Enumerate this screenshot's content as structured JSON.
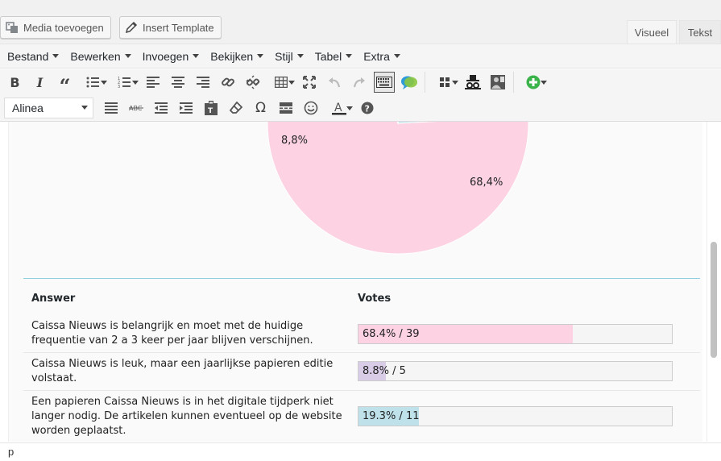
{
  "media_bar": {
    "add_media_label": "Media toevoegen",
    "insert_template_label": "Insert Template"
  },
  "tabs": {
    "visual": "Visueel",
    "text": "Tekst"
  },
  "menubar": [
    "Bestand",
    "Bewerken",
    "Invoegen",
    "Bekijken",
    "Stijl",
    "Tabel",
    "Extra"
  ],
  "format_select": {
    "value": "Alinea"
  },
  "pie": {
    "labels": [
      "8,8%",
      "68,4%"
    ],
    "slices": [
      {
        "value": 68.4,
        "color": "#fdd3e3"
      },
      {
        "value": 8.8,
        "color": "#d8cce6"
      },
      {
        "value": 19.3,
        "color": "#bee1ea"
      }
    ]
  },
  "table": {
    "header_answer": "Answer",
    "header_votes": "Votes",
    "rows": [
      {
        "answer": "Caissa Nieuws is belangrijk en moet met de huidige frequentie van 2 a 3 keer per jaar blijven verschijnen.",
        "votes": "68.4% / 39",
        "percent": 68.4,
        "color": "#fdd3e3"
      },
      {
        "answer": "Caissa Nieuws is leuk, maar een jaarlijkse papieren editie volstaat.",
        "votes": "8.8% / 5",
        "percent": 8.8,
        "color": "#d8cce6"
      },
      {
        "answer": "Een papieren Caissa Nieuws is in het digitale tijdperk niet langer nodig. De artikelen kunnen eventueel op de website worden geplaatst.",
        "votes": "19.3% / 11",
        "percent": 19.3,
        "color": "#bee1ea"
      }
    ]
  },
  "statusbar": {
    "path": "p"
  }
}
